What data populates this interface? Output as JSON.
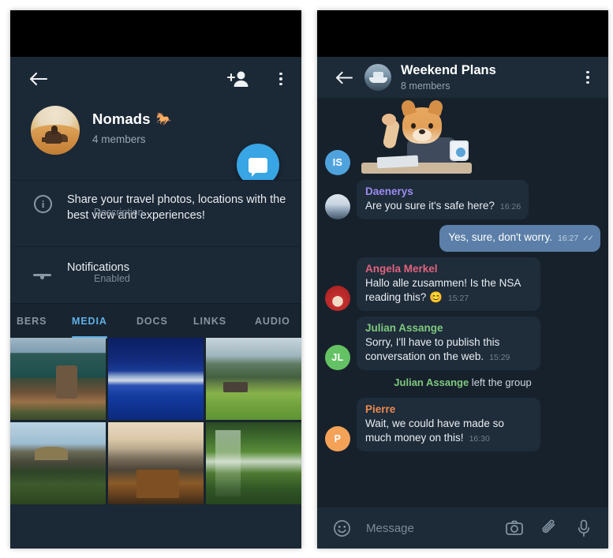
{
  "left_panel": {
    "topbar": {
      "back_icon": "arrow-left-icon",
      "add_member_icon": "add-person-icon",
      "overflow_icon": "more-vert-icon"
    },
    "group": {
      "name": "Nomads",
      "emoji": "🐎",
      "members": "4 members",
      "avatar_alt": "desert-camel-photo"
    },
    "fab": {
      "icon": "chat-bubble-icon"
    },
    "rows": [
      {
        "icon": "info-icon",
        "main": "Share your travel photos, locations with the best view and experiences!",
        "sub": "Description"
      },
      {
        "icon": "bell-icon",
        "main": "Notifications",
        "sub": "Enabled"
      }
    ],
    "tabs": [
      {
        "label": "BERS",
        "active": false
      },
      {
        "label": "MEDIA",
        "active": true
      },
      {
        "label": "DOCS",
        "active": false
      },
      {
        "label": "LINKS",
        "active": false
      },
      {
        "label": "AUDIO",
        "active": false
      }
    ],
    "media": [
      {
        "alt": "lake-with-rock-outcrop"
      },
      {
        "alt": "deep-blue-river-rapids"
      },
      {
        "alt": "green-meadow-cabin-mountains"
      },
      {
        "alt": "mountain-ridge-with-pines"
      },
      {
        "alt": "alpine-valley-wooden-hut"
      },
      {
        "alt": "birch-forest-waterfall"
      }
    ]
  },
  "right_panel": {
    "topbar": {
      "back_icon": "arrow-left-icon",
      "overflow_icon": "more-vert-icon",
      "title": "Weekend Plans",
      "subtitle": "8 members",
      "avatar_alt": "boat-on-water-photo"
    },
    "messages": [
      {
        "kind": "sticker",
        "avatar": "IS",
        "avatar_color": "#4fa3dd",
        "sticker_alt": "shiba-inu-at-desk-with-coffee-sticker"
      },
      {
        "kind": "in",
        "sender": "Daenerys",
        "sender_color": "#9b8cf0",
        "avatar": "",
        "avatar_color": "#8fa6bb",
        "avatar_alt": "daenerys-photo",
        "text": "Are you sure it's safe here?",
        "time": "16:26"
      },
      {
        "kind": "out",
        "text": "Yes, sure, don't worry.",
        "time": "16:27",
        "status": "read"
      },
      {
        "kind": "in",
        "sender": "Angela Merkel",
        "sender_color": "#e0637e",
        "avatar": "",
        "avatar_color": "#d03f40",
        "avatar_alt": "angela-merkel-photo",
        "text": "Hallo alle zusammen! Is the NSA reading this? 😊",
        "time": "15:27"
      },
      {
        "kind": "in",
        "sender": "Julian Assange",
        "sender_color": "#7ec97e",
        "avatar": "JL",
        "avatar_color": "#64c264",
        "text": "Sorry, I'll have to publish this conversation on the web.",
        "time": "15:29"
      },
      {
        "kind": "service",
        "who": "Julian Assange",
        "who_color": "#7ec97e",
        "action": " left the group"
      },
      {
        "kind": "in",
        "sender": "Pierre",
        "sender_color": "#eb8a4f",
        "avatar": "P",
        "avatar_color": "#f5a259",
        "text": "Wait, we could have made so much money on this!",
        "time": "16:30"
      }
    ],
    "input": {
      "emoji_icon": "smiley-icon",
      "placeholder": "Message",
      "camera_icon": "camera-icon",
      "attach_icon": "paperclip-icon",
      "mic_icon": "microphone-icon"
    }
  },
  "theme": {
    "accent": "#38a5e4",
    "tab_active": "#5fb0e8",
    "panel_bg_left": "#1b2836",
    "panel_bg_right": "#17212b",
    "bubble_in": "#1f2c3a",
    "bubble_out": "#5b7fa8",
    "page_bg": "#ffffff"
  }
}
